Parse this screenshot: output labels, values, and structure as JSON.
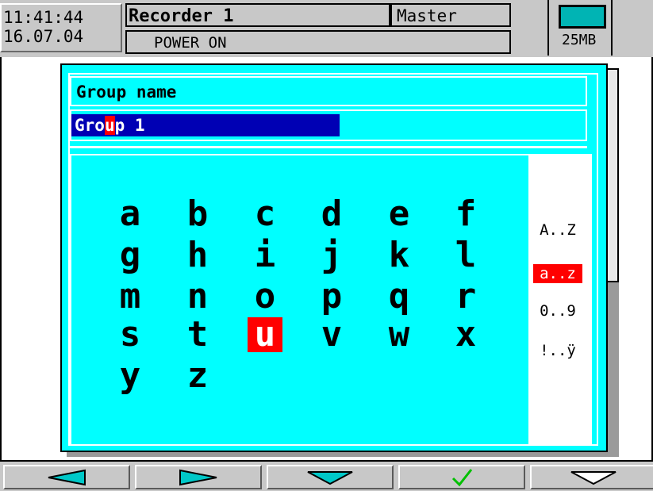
{
  "header": {
    "time": "11:41:44",
    "date": "16.07.04",
    "recorder_name": "Recorder 1",
    "role": "Master",
    "status": "POWER ON",
    "storage": "25MB"
  },
  "dialog": {
    "title": "Group name",
    "value_before_cursor": "Gro",
    "value_cursor_char": "u",
    "value_after_cursor": "p 1",
    "keyboard": {
      "rows": [
        [
          "a",
          "b",
          "c",
          "d",
          "e",
          "f"
        ],
        [
          "g",
          "h",
          "i",
          "j",
          "k",
          "l"
        ],
        [
          "m",
          "n",
          "o",
          "p",
          "q",
          "r"
        ],
        [
          "s",
          "t",
          "u",
          "v",
          "w",
          "x"
        ],
        [
          "y",
          "z"
        ]
      ],
      "selected": "u"
    },
    "modes": [
      {
        "label": "A..Z",
        "selected": false
      },
      {
        "label": "a..z",
        "selected": true
      },
      {
        "label": "0..9",
        "selected": false
      },
      {
        "label": "!..ÿ",
        "selected": false
      }
    ]
  },
  "softkeys": [
    {
      "icon": "arrow-left-icon",
      "label": "◀"
    },
    {
      "icon": "arrow-right-icon",
      "label": "▶"
    },
    {
      "icon": "arrow-down-icon",
      "label": "▼"
    },
    {
      "icon": "checkmark-icon",
      "label": "✓"
    },
    {
      "icon": "arrow-down-outline-icon",
      "label": "▽"
    }
  ],
  "colors": {
    "dialog_bg": "#00ffff",
    "field_bg": "#0000b4",
    "selection": "#ff0000",
    "check": "#00c000"
  }
}
